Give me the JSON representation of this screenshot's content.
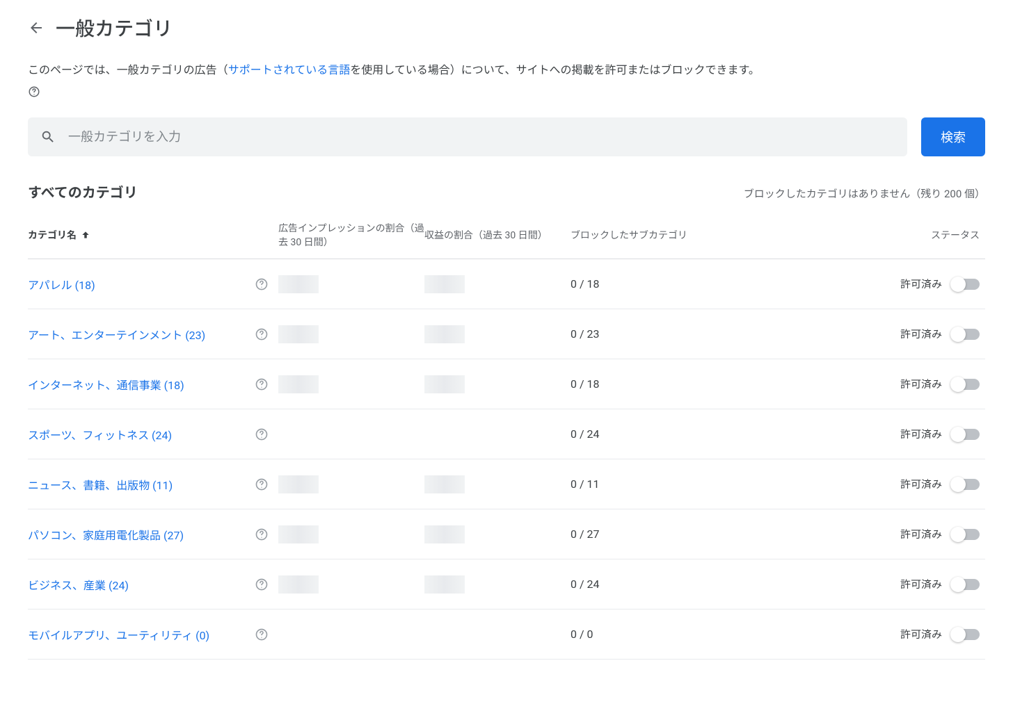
{
  "header": {
    "title": "一般カテゴリ"
  },
  "description": {
    "text_before": "このページでは、一般カテゴリの広告（",
    "link_text": "サポートされている言語",
    "text_after": "を使用している場合）について、サイトへの掲載を許可またはブロックできます。"
  },
  "search": {
    "placeholder": "一般カテゴリを入力",
    "button_label": "検索"
  },
  "subheader": {
    "all_categories": "すべてのカテゴリ",
    "blocked_info": "ブロックしたカテゴリはありません（残り 200 個）"
  },
  "table": {
    "columns": {
      "name": "カテゴリ名",
      "impressions": "広告インプレッションの割合（過去 30 日間）",
      "revenue": "収益の割合（過去 30 日間）",
      "blocked_sub": "ブロックしたサブカテゴリ",
      "status": "ステータス"
    },
    "rows": [
      {
        "name": "アパレル (18)",
        "blocked": "0 / 18",
        "status": "許可済み",
        "redacted": true
      },
      {
        "name": "アート、エンターテインメント (23)",
        "blocked": "0 / 23",
        "status": "許可済み",
        "redacted": true
      },
      {
        "name": "インターネット、通信事業 (18)",
        "blocked": "0 / 18",
        "status": "許可済み",
        "redacted": true
      },
      {
        "name": "スポーツ、フィットネス (24)",
        "blocked": "0 / 24",
        "status": "許可済み",
        "redacted": false
      },
      {
        "name": "ニュース、書籍、出版物 (11)",
        "blocked": "0 / 11",
        "status": "許可済み",
        "redacted": true
      },
      {
        "name": "パソコン、家庭用電化製品 (27)",
        "blocked": "0 / 27",
        "status": "許可済み",
        "redacted": true
      },
      {
        "name": "ビジネス、産業 (24)",
        "blocked": "0 / 24",
        "status": "許可済み",
        "redacted": true
      },
      {
        "name": "モバイルアプリ、ユーティリティ (0)",
        "blocked": "0 / 0",
        "status": "許可済み",
        "redacted": false
      }
    ]
  }
}
